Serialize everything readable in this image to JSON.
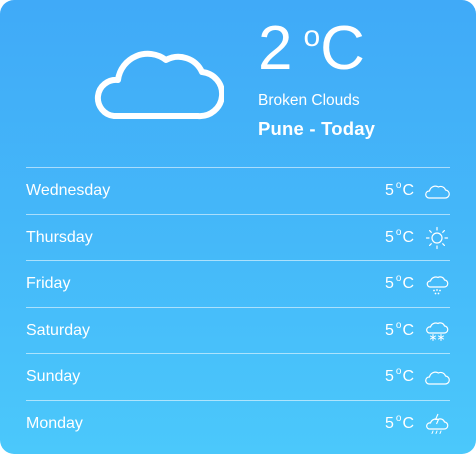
{
  "current": {
    "temperature": "2",
    "degree_symbol": "o",
    "unit": "C",
    "condition": "Broken Clouds",
    "location": "Pune - Today",
    "icon": "cloud-icon"
  },
  "forecast": [
    {
      "day": "Wednesday",
      "temp": "5",
      "degree_symbol": "o",
      "unit": "C",
      "icon": "cloud-icon"
    },
    {
      "day": "Thursday",
      "temp": "5",
      "degree_symbol": "o",
      "unit": "C",
      "icon": "sun-icon"
    },
    {
      "day": "Friday",
      "temp": "5",
      "degree_symbol": "o",
      "unit": "C",
      "icon": "rain-cloud-icon"
    },
    {
      "day": "Saturday",
      "temp": "5",
      "degree_symbol": "o",
      "unit": "C",
      "icon": "snow-cloud-icon"
    },
    {
      "day": "Sunday",
      "temp": "5",
      "degree_symbol": "o",
      "unit": "C",
      "icon": "cloud-icon"
    },
    {
      "day": "Monday",
      "temp": "5",
      "degree_symbol": "o",
      "unit": "C",
      "icon": "thunder-cloud-icon"
    }
  ],
  "colors": {
    "gradient_top": "#40aaf8",
    "gradient_bottom": "#4bc8fb",
    "text": "#ffffff"
  }
}
